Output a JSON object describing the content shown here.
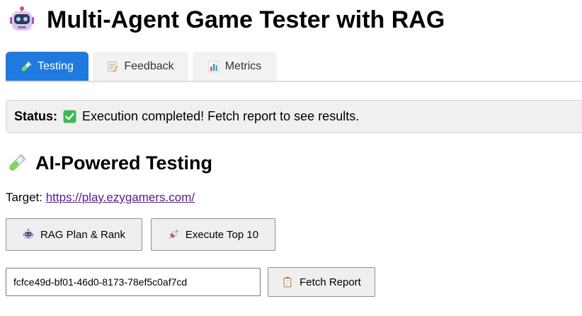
{
  "app": {
    "title": "Multi-Agent Game Tester with RAG",
    "logo_icon": "robot-icon"
  },
  "tabs": [
    {
      "label": "Testing",
      "icon": "test-tube-icon",
      "active": true
    },
    {
      "label": "Feedback",
      "icon": "memo-icon",
      "active": false
    },
    {
      "label": "Metrics",
      "icon": "bar-chart-icon",
      "active": false
    }
  ],
  "status": {
    "label": "Status:",
    "icon": "check-mark-icon",
    "text": "Execution completed! Fetch report to see results."
  },
  "section": {
    "title": "AI-Powered Testing",
    "icon": "test-tube-icon"
  },
  "target": {
    "label": "Target:",
    "url": "https://play.ezygamers.com/"
  },
  "actions": {
    "plan_label": "RAG Plan & Rank",
    "plan_icon": "robot-icon",
    "execute_label": "Execute Top 10",
    "execute_icon": "syringe-icon",
    "fetch_label": "Fetch Report",
    "fetch_icon": "clipboard-icon"
  },
  "report": {
    "run_id": "fcfce49d-bf01-46d0-8173-78ef5c0af7cd"
  },
  "colors": {
    "active_tab": "#1f7ae0",
    "link": "#551a8b",
    "status_check": "#3fb950"
  }
}
